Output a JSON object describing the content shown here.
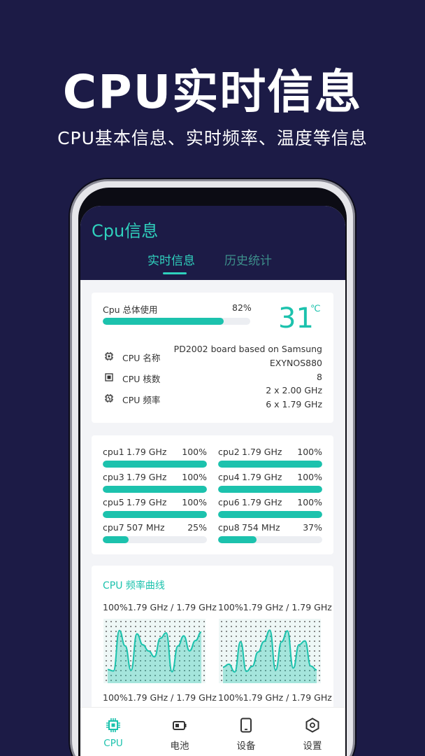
{
  "promo": {
    "title": "CPU实时信息",
    "subtitle": "CPU基本信息、实时频率、温度等信息"
  },
  "header": {
    "title": "Cpu信息",
    "tabs": [
      {
        "label": "实时信息",
        "active": true
      },
      {
        "label": "历史统计",
        "active": false
      }
    ]
  },
  "usage": {
    "label": "Cpu 总体使用",
    "percent_text": "82%",
    "fraction": 0.82
  },
  "temperature": {
    "value": "31",
    "unit": "℃"
  },
  "info": {
    "name_label": "CPU 名称",
    "name_value_line1": "PD2002 board based on Samsung",
    "name_value_line2": "EXYNOS880",
    "cores_label": "CPU 核数",
    "cores_value": "8",
    "freq_label": "CPU 频率",
    "freq_value_line1": "2 x 2.00 GHz",
    "freq_value_line2": "6 x 1.79 GHz"
  },
  "cores": [
    {
      "name": "cpu1",
      "freq": "1.79 GHz",
      "percent": "100%",
      "fraction": 1.0
    },
    {
      "name": "cpu2",
      "freq": "1.79 GHz",
      "percent": "100%",
      "fraction": 1.0
    },
    {
      "name": "cpu3",
      "freq": "1.79 GHz",
      "percent": "100%",
      "fraction": 1.0
    },
    {
      "name": "cpu4",
      "freq": "1.79 GHz",
      "percent": "100%",
      "fraction": 1.0
    },
    {
      "name": "cpu5",
      "freq": "1.79 GHz",
      "percent": "100%",
      "fraction": 1.0
    },
    {
      "name": "cpu6",
      "freq": "1.79 GHz",
      "percent": "100%",
      "fraction": 1.0
    },
    {
      "name": "cpu7",
      "freq": "507 MHz",
      "percent": "25%",
      "fraction": 0.25
    },
    {
      "name": "cpu8",
      "freq": "754 MHz",
      "percent": "37%",
      "fraction": 0.37
    }
  ],
  "freq_curve": {
    "title": "CPU 频率曲线",
    "graphs": [
      {
        "label": "100%1.79 GHz / 1.79 GHz"
      },
      {
        "label": "100%1.79 GHz / 1.79 GHz"
      },
      {
        "label": "100%1.79 GHz / 1.79 GHz"
      },
      {
        "label": "100%1.79 GHz / 1.79 GHz"
      }
    ]
  },
  "nav": [
    {
      "label": "CPU",
      "icon": "cpu-chip-icon",
      "active": true
    },
    {
      "label": "电池",
      "icon": "battery-icon",
      "active": false
    },
    {
      "label": "设备",
      "icon": "phone-device-icon",
      "active": false
    },
    {
      "label": "设置",
      "icon": "settings-hexagon-icon",
      "active": false
    }
  ],
  "colors": {
    "background": "#1c1b46",
    "accent": "#1cc2ad",
    "accent_light": "#2fd1bd"
  }
}
